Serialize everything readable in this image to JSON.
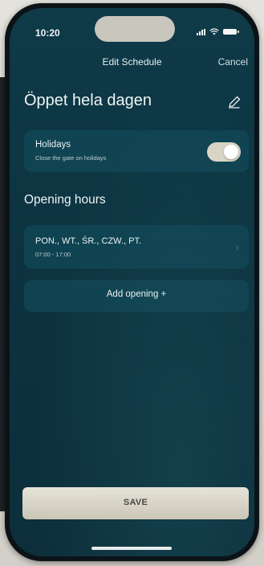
{
  "status_bar": {
    "time": "10:20"
  },
  "nav": {
    "title": "Edit Schedule",
    "cancel_label": "Cancel"
  },
  "page": {
    "title": "Öppet hela dagen"
  },
  "holidays": {
    "title": "Holidays",
    "subtitle": "Close the gate on holidays",
    "enabled": true
  },
  "opening_hours": {
    "section_title": "Opening hours",
    "items": [
      {
        "days": "PON., WT., ŚR., CZW., PT.",
        "hours": "07:00 - 17:00"
      }
    ],
    "add_label": "Add opening +"
  },
  "actions": {
    "save_label": "SAVE"
  },
  "colors": {
    "background": "#0d3340",
    "card": "#14505f",
    "toggle_on": "#d9d5c6",
    "save_button": "#d9d5c6"
  },
  "icons": {
    "edit": "pencil-icon",
    "chevron": "chevron-right-icon"
  }
}
